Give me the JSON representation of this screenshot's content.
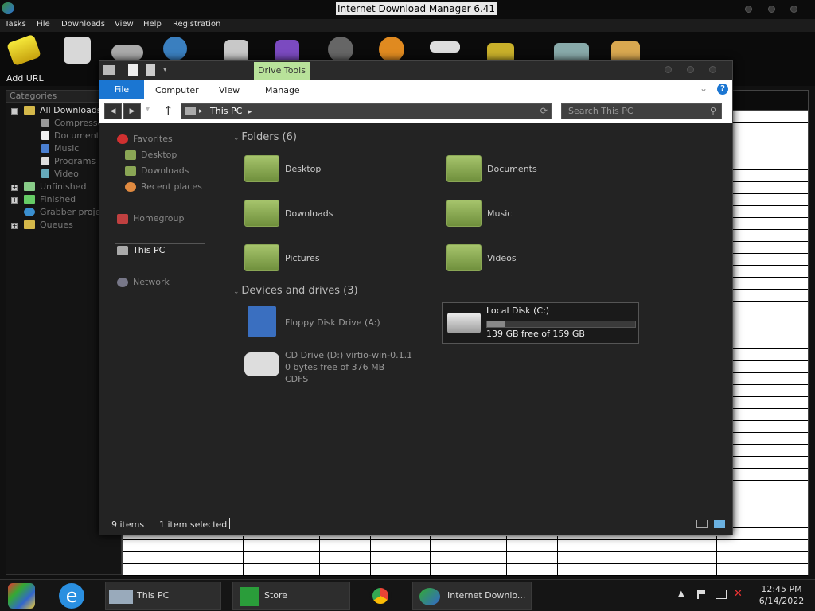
{
  "idm": {
    "title": "Internet Download Manager 6.41",
    "menu": [
      "Tasks",
      "File",
      "Downloads",
      "View",
      "Help",
      "Registration"
    ],
    "add_url_label": "Add URL",
    "categories_header": "Categories",
    "tree": {
      "all": "All Downloads",
      "compressed": "Compresse",
      "documents": "Documents",
      "music": "Music",
      "programs": "Programs",
      "video": "Video",
      "unfinished": "Unfinished",
      "finished": "Finished",
      "grabber": "Grabber projec",
      "queues": "Queues"
    }
  },
  "explorer": {
    "drive_tools": "Drive Tools",
    "ribbon": {
      "file": "File",
      "computer": "Computer",
      "view": "View",
      "manage": "Manage"
    },
    "address": "This PC",
    "search_placeholder": "Search This PC",
    "nav": {
      "favorites": "Favorites",
      "desktop": "Desktop",
      "downloads": "Downloads",
      "recent": "Recent places",
      "homegroup": "Homegroup",
      "thispc": "This PC",
      "network": "Network"
    },
    "folders_header": "Folders (6)",
    "folders": [
      "Desktop",
      "Documents",
      "Downloads",
      "Music",
      "Pictures",
      "Videos"
    ],
    "devices_header": "Devices and drives (3)",
    "floppy": "Floppy Disk Drive (A:)",
    "cd": {
      "name": "CD Drive (D:) virtio-win-0.1.1",
      "free": "0 bytes free of 376 MB",
      "fs": "CDFS"
    },
    "local": {
      "name": "Local Disk (C:)",
      "free": "139 GB free of 159 GB",
      "used_fraction": 0.126
    },
    "status": {
      "items": "9 items",
      "selected": "1 item selected"
    }
  },
  "taskbar": {
    "thispc": "This PC",
    "store": "Store",
    "idm": "Internet Downlo...",
    "time": "12:45 PM",
    "date": "6/14/2022"
  }
}
